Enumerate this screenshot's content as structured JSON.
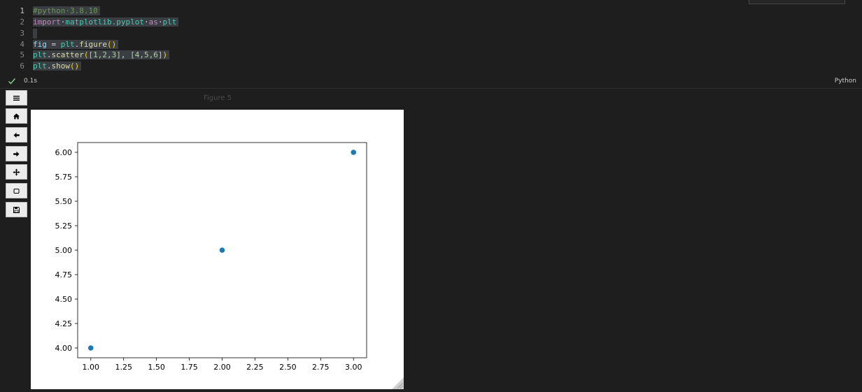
{
  "code": {
    "line_numbers": [
      "1",
      "2",
      "3",
      "4",
      "5",
      "6"
    ],
    "line1": {
      "comment": "#python·3.8.10"
    },
    "line2": {
      "kw_import": "import",
      "module": "matplotlib.pyplot",
      "kw_as": "as",
      "alias": "plt"
    },
    "line4": {
      "var": "fig",
      "op": " = ",
      "obj": "plt",
      "dot": ".",
      "func": "figure",
      "paren_open": "(",
      "paren_close": ")"
    },
    "line5": {
      "obj": "plt",
      "dot": ".",
      "func": "scatter",
      "paren_open": "(",
      "list1": "[1,2,3]",
      "sep": ", ",
      "list2": "[4,5,6]",
      "paren_close": ")"
    },
    "line6": {
      "obj": "plt",
      "dot": ".",
      "func": "show",
      "paren_open": "(",
      "paren_close": ")"
    }
  },
  "status": {
    "check_icon": "check-icon",
    "execution_time": "0.1s",
    "language": "Python"
  },
  "figure": {
    "title": "Figure 5",
    "toolbar_icons": [
      "menu-icon",
      "home-icon",
      "back-arrow-icon",
      "forward-arrow-icon",
      "pan-icon",
      "zoom-rect-icon",
      "save-icon"
    ]
  },
  "chart_data": {
    "type": "scatter",
    "x": [
      1,
      2,
      3
    ],
    "y": [
      4,
      5,
      6
    ],
    "xlim": [
      0.9,
      3.1
    ],
    "ylim": [
      3.9,
      6.1
    ],
    "xticks": [
      "1.00",
      "1.25",
      "1.50",
      "1.75",
      "2.00",
      "2.25",
      "2.50",
      "2.75",
      "3.00"
    ],
    "yticks": [
      "4.00",
      "4.25",
      "4.50",
      "4.75",
      "5.00",
      "5.25",
      "5.50",
      "5.75",
      "6.00"
    ],
    "marker_color": "#1f77b4",
    "title": "",
    "xlabel": "",
    "ylabel": "",
    "grid": false
  }
}
